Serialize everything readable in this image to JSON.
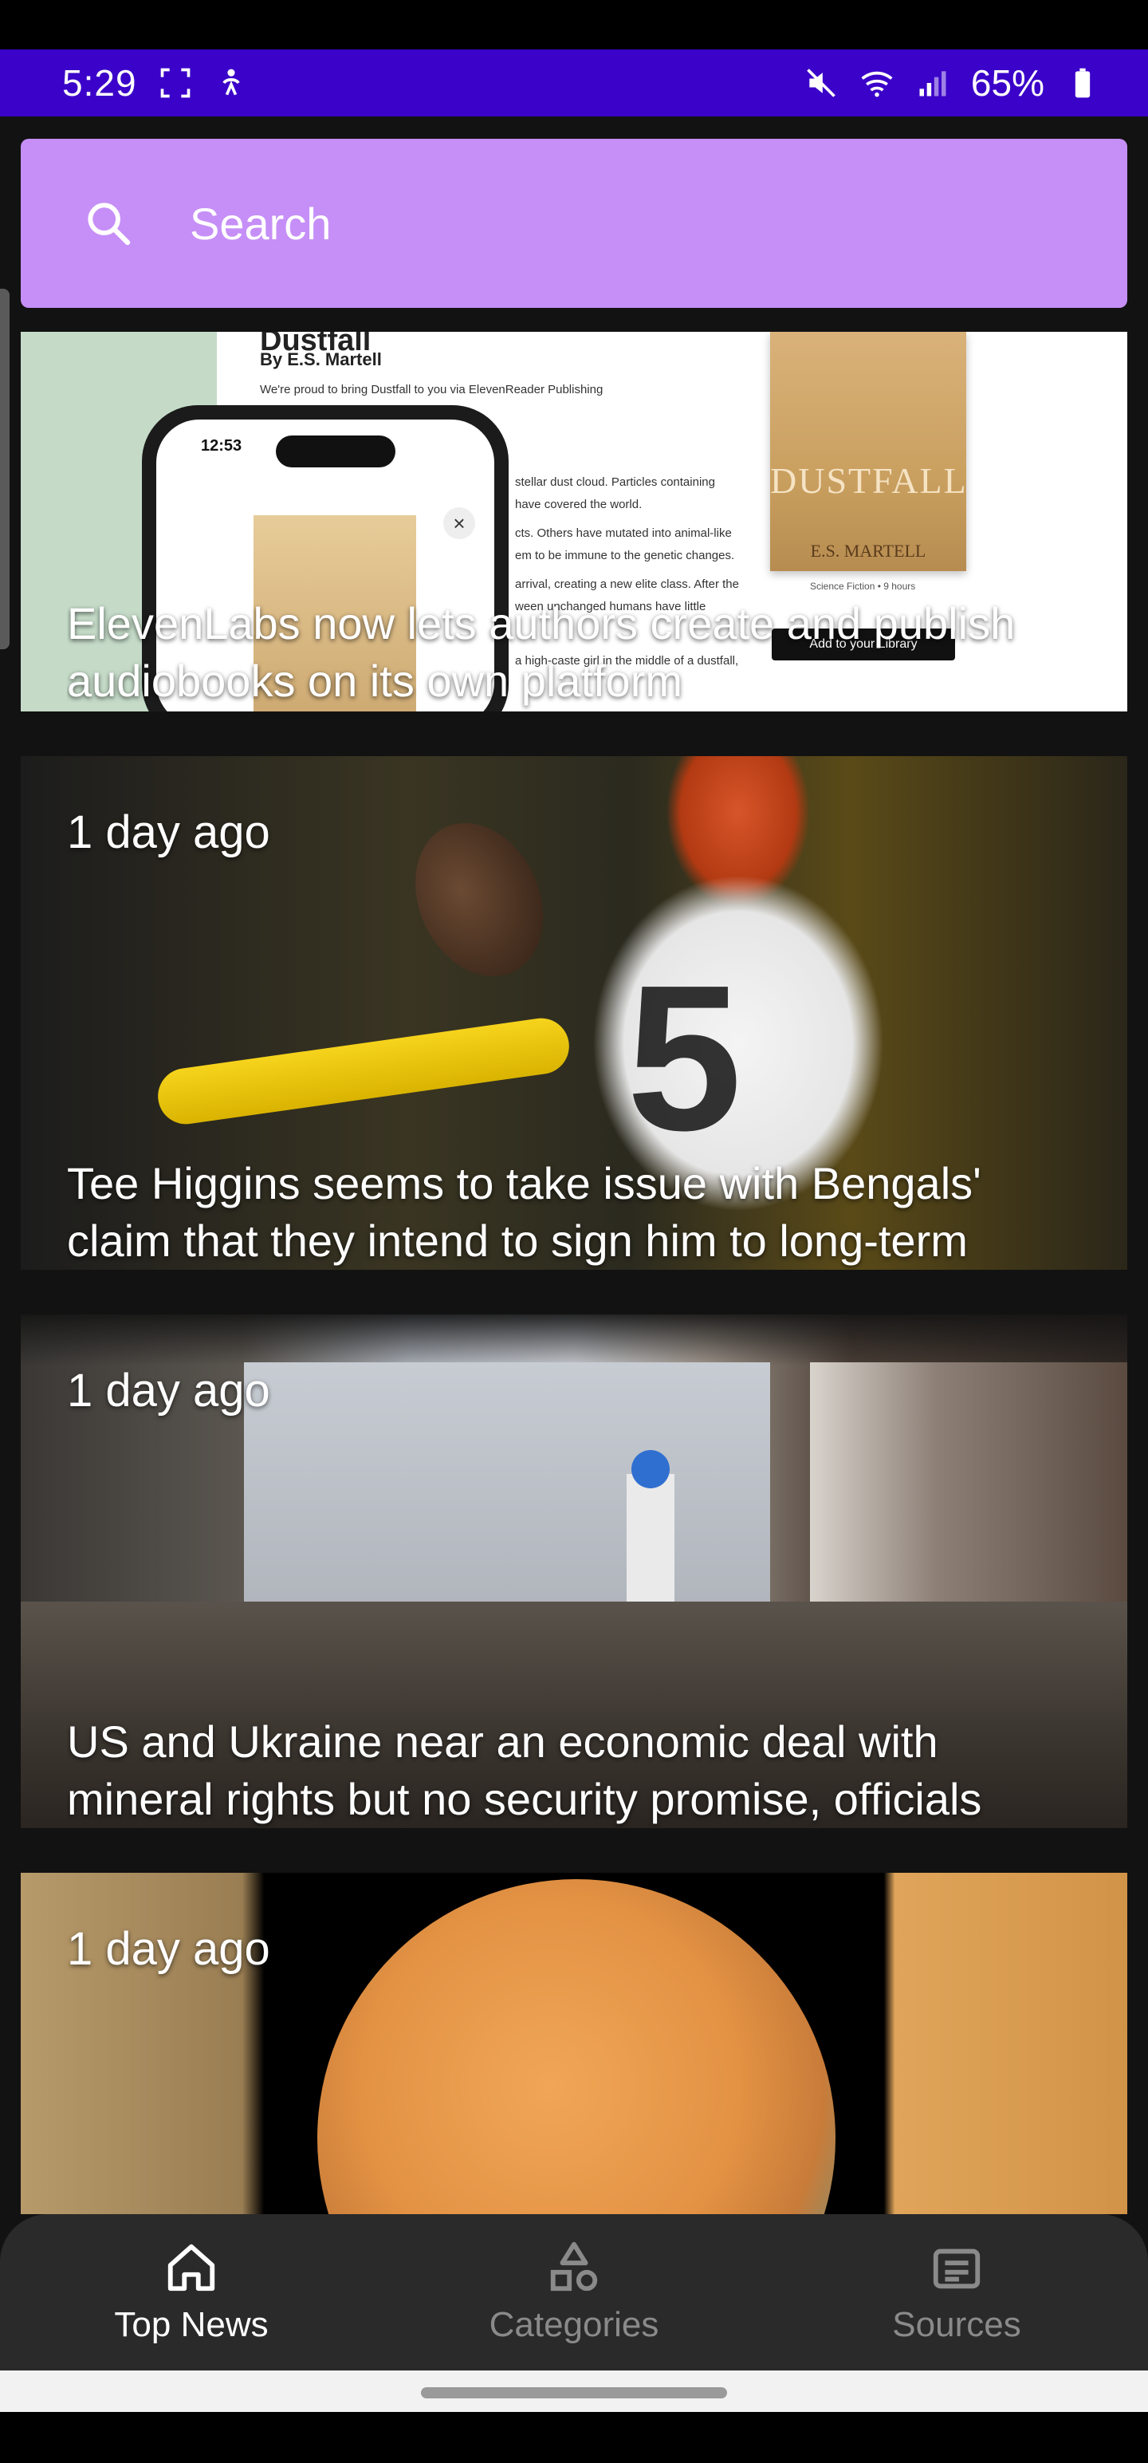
{
  "status_bar": {
    "time": "5:29",
    "battery": "65%",
    "background": "#3b02c9"
  },
  "search": {
    "placeholder": "Search",
    "background": "#c68ff7"
  },
  "articles": [
    {
      "time": "",
      "headline": "ElevenLabs now lets authors create and publish audiobooks on its own platform",
      "image": {
        "doc_title": "Dustfall",
        "doc_author": "By E.S. Martell",
        "doc_line_1": "We're proud to bring Dustfall to you via ElevenReader Publishing",
        "doc_line_2": "stellar dust cloud. Particles containing",
        "doc_line_3": "have covered the world.",
        "doc_line_4": "cts. Others have mutated into animal-like",
        "doc_line_5": "em to be immune to the genetic changes.",
        "doc_line_6": "arrival, creating a new elite class. After the",
        "doc_line_7": "ween unchanged humans have little",
        "doc_line_8": "a high-caste girl in the middle of a dustfall,",
        "phone_time": "12:53",
        "book_title": "DUSTFALL",
        "book_author": "E.S. MARTELL",
        "book_meta": "Science Fiction • 9 hours",
        "library_button": "Add to your Library"
      }
    },
    {
      "time": "1 day ago",
      "headline": "Tee Higgins seems to take issue with Bengals' claim that they intend to sign him to long-term",
      "image": {
        "jersey_number": "5"
      }
    },
    {
      "time": "1 day ago",
      "headline": "US and Ukraine near an economic deal with mineral rights but no security promise, officials"
    },
    {
      "time": "1 day ago",
      "headline": ""
    }
  ],
  "bottom_nav": [
    {
      "label": "Top News",
      "icon": "home-icon",
      "active": true
    },
    {
      "label": "Categories",
      "icon": "shapes-icon",
      "active": false
    },
    {
      "label": "Sources",
      "icon": "article-icon",
      "active": false
    }
  ]
}
